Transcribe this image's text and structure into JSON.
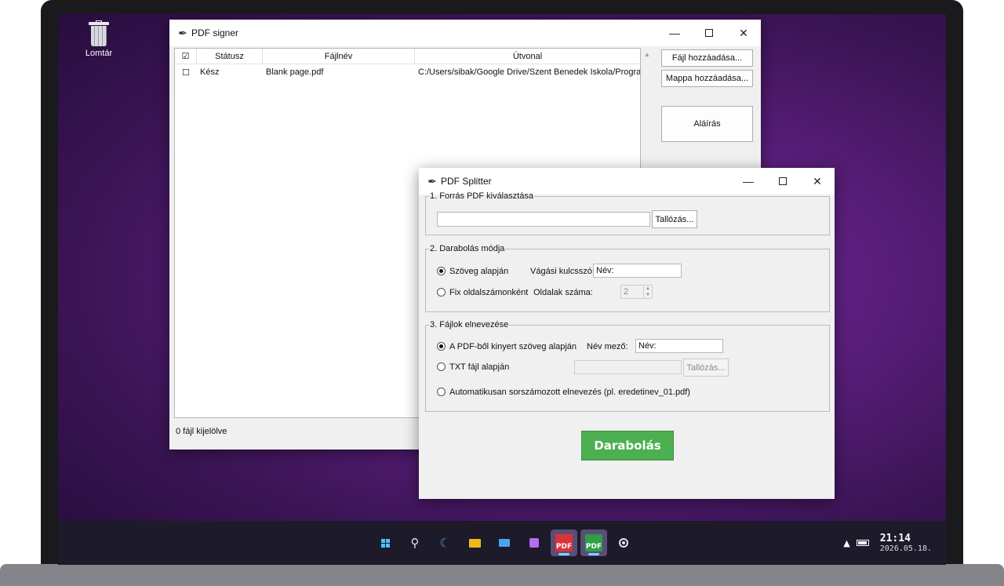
{
  "desktop": {
    "recycle_bin_label": "Lomtár"
  },
  "signer": {
    "title": "PDF signer",
    "columns": [
      "Státusz",
      "Fájlnév",
      "Útvonal"
    ],
    "header_check": "☑",
    "rows": [
      {
        "check": "☐",
        "status": "Kész",
        "filename": "Blank page.pdf",
        "path": "C:/Users/sibak/Google Drive/Szent Benedek Iskola/Progra"
      }
    ],
    "add_file_label": "Fájl hozzáadása...",
    "add_folder_label": "Mappa hozzáadása...",
    "sign_label": "Aláírás",
    "status_text": "0 fájl kijelölve"
  },
  "splitter": {
    "title": "PDF Splitter",
    "source": {
      "legend": "1. Forrás PDF kiválasztása",
      "path_value": "",
      "browse_label": "Tallózás..."
    },
    "mode": {
      "legend": "2. Darabolás módja",
      "by_text_label": "Szöveg alapján",
      "keyword_label": "Vágási kulcsszó:",
      "keyword_value": "Név:",
      "by_pages_label": "Fix oldalszámonként",
      "pages_label": "Oldalak száma:",
      "pages_value": "2"
    },
    "naming": {
      "legend": "3. Fájlok elnevezése",
      "from_pdf_label": "A PDF-ből kinyert szöveg alapján",
      "name_field_label": "Név mező:",
      "name_field_value": "Név:",
      "from_txt_label": "TXT fájl alapján",
      "txt_value": "",
      "txt_browse_label": "Tallózás...",
      "auto_label": "Automatikusan sorszámozott elnevezés (pl. eredetinev_01.pdf)"
    },
    "split_label": "Darabolás"
  },
  "taskbar": {
    "icons": [
      "start-icon",
      "search-icon",
      "moon-icon",
      "folder-icon",
      "mail-icon",
      "store-icon",
      "pdf-app-red-icon",
      "pdf-app-green-icon",
      "target-icon"
    ],
    "pdf_badge_text": "PDF",
    "time": "21:14",
    "date": "2026.05.18."
  },
  "colors": {
    "split_button": "#4caf50",
    "desktop_accent": "#5c1f7e",
    "pdf_red": "#d9343a",
    "pdf_green": "#2f9e44"
  }
}
